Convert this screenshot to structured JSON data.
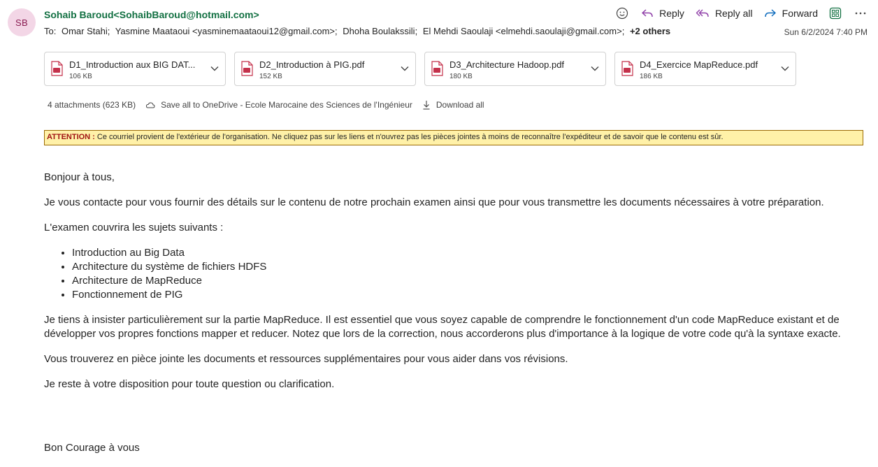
{
  "sender": {
    "initials": "SB",
    "name_email": "Sohaib Baroud<SohaibBaroud@hotmail.com>",
    "avatar_bg": "#f3d6e6"
  },
  "recipients": {
    "to_label": "To:",
    "list": [
      "Omar Stahi;",
      "Yasmine Maataoui <yasminemaataoui12@gmail.com>;",
      "Dhoha Boulakssili;",
      "El Mehdi Saoulaji <elmehdi.saoulaji@gmail.com>;"
    ],
    "others": "+2 others"
  },
  "actions": {
    "reply": "Reply",
    "reply_all": "Reply all",
    "forward": "Forward"
  },
  "date": "Sun 6/2/2024 7:40 PM",
  "attachments": [
    {
      "name": "D1_Introduction aux BIG DAT...",
      "size": "106 KB"
    },
    {
      "name": "D2_Introduction à PIG.pdf",
      "size": "152 KB"
    },
    {
      "name": "D3_Architecture Hadoop.pdf",
      "size": "180 KB"
    },
    {
      "name": "D4_Exercice MapReduce.pdf",
      "size": "186 KB"
    }
  ],
  "attachment_bar": {
    "count": "4 attachments (623 KB)",
    "save_all": "Save all to OneDrive - Ecole Marocaine des Sciences de l'Ingénieur",
    "download_all": "Download all"
  },
  "banner": {
    "label": "ATTENTION :",
    "text": " Ce courriel provient de l'extérieur de l'organisation. Ne cliquez pas sur les liens et n'ouvrez pas les pièces jointes à moins de reconnaître l'expéditeur et de savoir que le contenu est sûr."
  },
  "body": {
    "greeting": "Bonjour à tous,",
    "p1": "Je vous contacte pour vous fournir des détails sur le contenu de notre prochain examen ainsi que pour vous transmettre les documents nécessaires à votre préparation.",
    "p2": "L'examen couvrira les sujets suivants :",
    "topics": [
      "Introduction au Big Data",
      "Architecture du système de fichiers HDFS",
      "Architecture de MapReduce",
      "Fonctionnement de PIG"
    ],
    "p3": "Je tiens à insister particulièrement sur la partie MapReduce. Il est essentiel que vous soyez capable de comprendre le fonctionnement d'un code MapReduce existant et de développer vos propres fonctions mapper et reducer. Notez que lors de la correction, nous accorderons plus d'importance à la logique de votre code qu'à la syntaxe exacte.",
    "p4": "Vous trouverez en pièce jointe les documents et ressources supplémentaires pour vous aider dans vos révisions.",
    "p5": "Je reste à votre disposition pour toute question ou clarification.",
    "closing": "Bon Courage à vous"
  }
}
